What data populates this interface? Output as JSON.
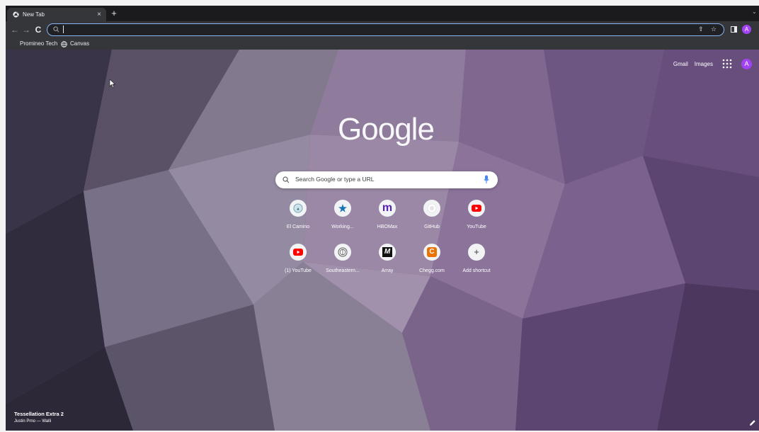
{
  "tab": {
    "title": "New Tab",
    "close_glyph": "×",
    "new_tab_glyph": "+"
  },
  "toolbar": {
    "back_glyph": "←",
    "forward_glyph": "→",
    "reload_glyph": "C",
    "omnibox_value": ""
  },
  "bookmarks": [
    {
      "label": "Promineo Tech"
    },
    {
      "label": "Canvas",
      "icon": "globe-icon"
    }
  ],
  "profile": {
    "initial": "A",
    "color": "#a142f4"
  },
  "ntp": {
    "top_links": {
      "gmail": "Gmail",
      "images": "Images"
    },
    "logo": "Google",
    "search_placeholder": "Search Google or type a URL",
    "shortcuts": [
      {
        "label": "El Camino",
        "icon": "el-camino-icon"
      },
      {
        "label": "Working...",
        "icon": "star-icon"
      },
      {
        "label": "HBOMax",
        "icon": "hbomax-icon",
        "glyph": "m"
      },
      {
        "label": "GitHub",
        "icon": "github-icon"
      },
      {
        "label": "YouTube",
        "icon": "youtube-icon"
      },
      {
        "label": "(1) YouTube",
        "icon": "youtube-icon"
      },
      {
        "label": "Southeastern...",
        "icon": "southeastern-icon"
      },
      {
        "label": "Array",
        "icon": "array-icon",
        "glyph": "M"
      },
      {
        "label": "Chegg.com",
        "icon": "chegg-icon",
        "glyph": "C"
      },
      {
        "label": "Add shortcut",
        "icon": "plus-icon",
        "glyph": "+"
      }
    ],
    "background_credit": {
      "title": "Tessellation Extra 2",
      "author": "Justin Prno — Walli"
    }
  },
  "colors": {
    "accent": "#8ab4f8",
    "youtube": "#ff0000",
    "chegg": "#eb7100",
    "hbomax": "#5822b4"
  }
}
